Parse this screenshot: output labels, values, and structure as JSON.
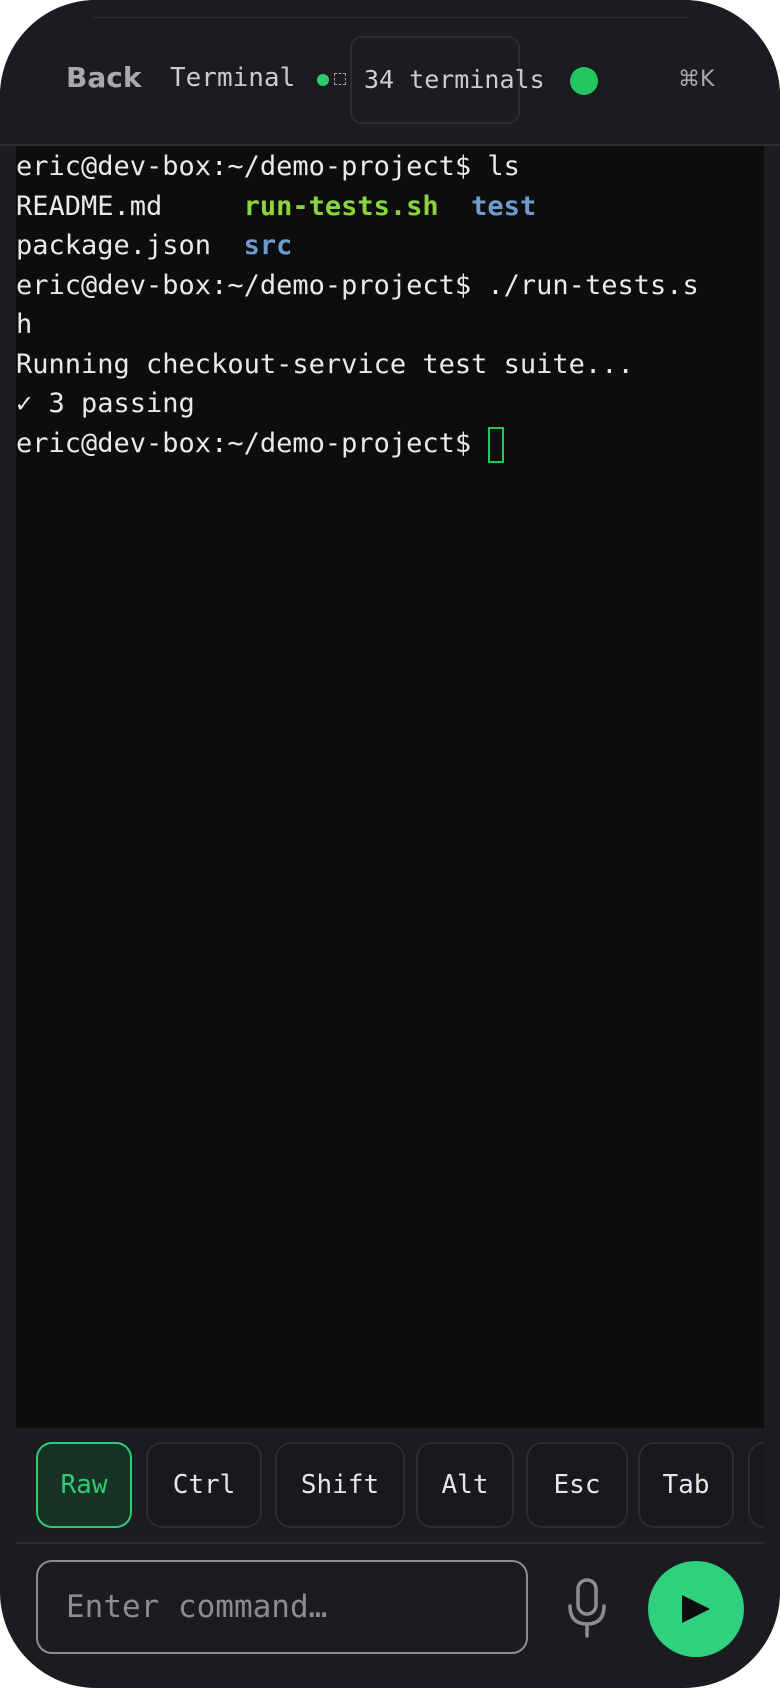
{
  "header": {
    "back_label": "Back",
    "title": "Terminal",
    "terminal_count": "34 terminals",
    "shortcut": "⌘K",
    "status_color": "#22c55e"
  },
  "terminal": {
    "lines": [
      {
        "parts": [
          {
            "text": "eric@dev-box:~/demo-project$ ls",
            "style": "plain"
          }
        ]
      },
      {
        "parts": [
          {
            "text": "README.md     ",
            "style": "plain"
          },
          {
            "text": "run-tests.sh",
            "style": "exec"
          },
          {
            "text": "  ",
            "style": "plain"
          },
          {
            "text": "test",
            "style": "dir"
          }
        ]
      },
      {
        "parts": [
          {
            "text": "package.json  ",
            "style": "plain"
          },
          {
            "text": "src",
            "style": "dir"
          }
        ]
      },
      {
        "parts": [
          {
            "text": "eric@dev-box:~/demo-project$ ./run-tests.s",
            "style": "plain"
          }
        ]
      },
      {
        "parts": [
          {
            "text": "h",
            "style": "plain"
          }
        ]
      },
      {
        "parts": [
          {
            "text": "Running checkout-service test suite...",
            "style": "plain"
          }
        ]
      },
      {
        "parts": [
          {
            "text": "✓ 3 passing",
            "style": "plain"
          }
        ]
      },
      {
        "parts": [
          {
            "text": "eric@dev-box:~/demo-project$ ",
            "style": "plain"
          }
        ],
        "cursor": true
      }
    ],
    "colors": {
      "exec": "#8bd43f",
      "dir": "#6f9ccf",
      "cursor": "#22c55e"
    }
  },
  "keys": [
    {
      "label": "Raw",
      "active": true
    },
    {
      "label": "Ctrl",
      "active": false
    },
    {
      "label": "Shift",
      "active": false
    },
    {
      "label": "Alt",
      "active": false
    },
    {
      "label": "Esc",
      "active": false
    },
    {
      "label": "Tab",
      "active": false
    }
  ],
  "input": {
    "placeholder": "Enter command…",
    "value": ""
  },
  "icons": {
    "mic": "microphone-icon",
    "send": "play-send-icon"
  },
  "accent_color": "#2fd07e"
}
